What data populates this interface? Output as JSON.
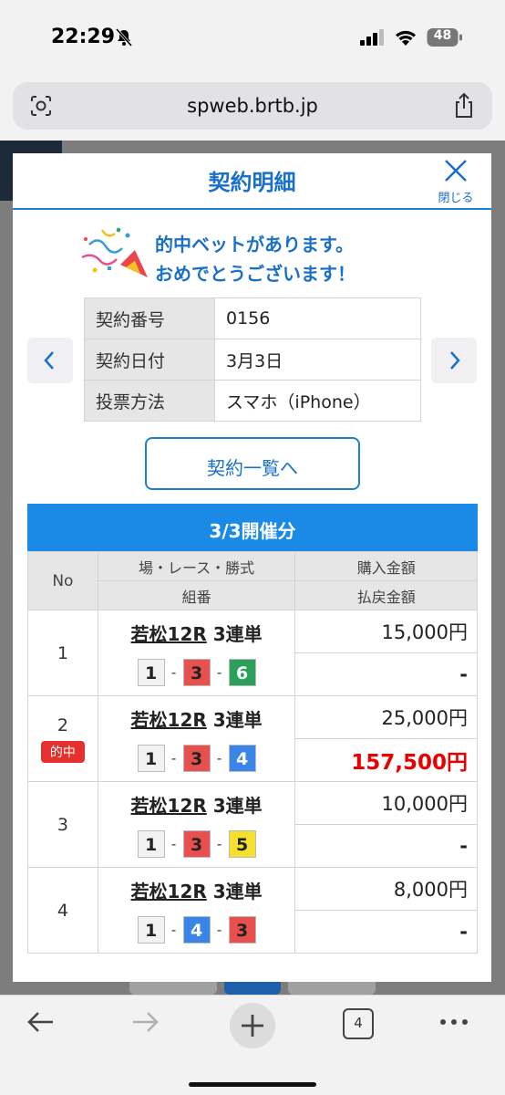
{
  "status": {
    "time": "22:29",
    "battery": "48"
  },
  "browser": {
    "url": "spweb.brtb.jp",
    "tab_count": "4"
  },
  "modal": {
    "title": "契約明細",
    "close_label": "閉じる",
    "congrats_line1": "的中ベットがあります。",
    "congrats_line2": "おめでとうございます！",
    "info": [
      {
        "label": "契約番号",
        "value": "0156"
      },
      {
        "label": "契約日付",
        "value": "3月3日"
      },
      {
        "label": "投票方法",
        "value": "スマホ（iPhone）"
      }
    ],
    "list_button": "契約一覧へ",
    "day_header": "3/3開催分",
    "table_headers": {
      "no": "No",
      "race": "場・レース・勝式",
      "combo": "組番",
      "purchase": "購入金額",
      "payout": "払戻金額"
    },
    "hit_label": "的中",
    "bets": [
      {
        "no": "1",
        "venue": "若松12R",
        "type": "3連単",
        "combo": [
          "1",
          "3",
          "6"
        ],
        "purchase": "15,000円",
        "payout": "-",
        "hit": false
      },
      {
        "no": "2",
        "venue": "若松12R",
        "type": "3連単",
        "combo": [
          "1",
          "3",
          "4"
        ],
        "purchase": "25,000円",
        "payout": "157,500円",
        "hit": true
      },
      {
        "no": "3",
        "venue": "若松12R",
        "type": "3連単",
        "combo": [
          "1",
          "3",
          "5"
        ],
        "purchase": "10,000円",
        "payout": "-",
        "hit": false
      },
      {
        "no": "4",
        "venue": "若松12R",
        "type": "3連単",
        "combo": [
          "1",
          "4",
          "3"
        ],
        "purchase": "8,000円",
        "payout": "-",
        "hit": false
      }
    ]
  },
  "colors": {
    "accent": "#1a8ae6",
    "title_blue": "#1a6fc8",
    "hit_red": "#e60000",
    "boat": {
      "1": "#f2f2f2",
      "2": "#333333",
      "3": "#e85050",
      "4": "#3a86e8",
      "5": "#f5e030",
      "6": "#2aa05a"
    },
    "boat_text": {
      "1": "#222222",
      "2": "#ffffff",
      "3": "#222222",
      "4": "#ffffff",
      "5": "#222222",
      "6": "#ffffff"
    }
  }
}
